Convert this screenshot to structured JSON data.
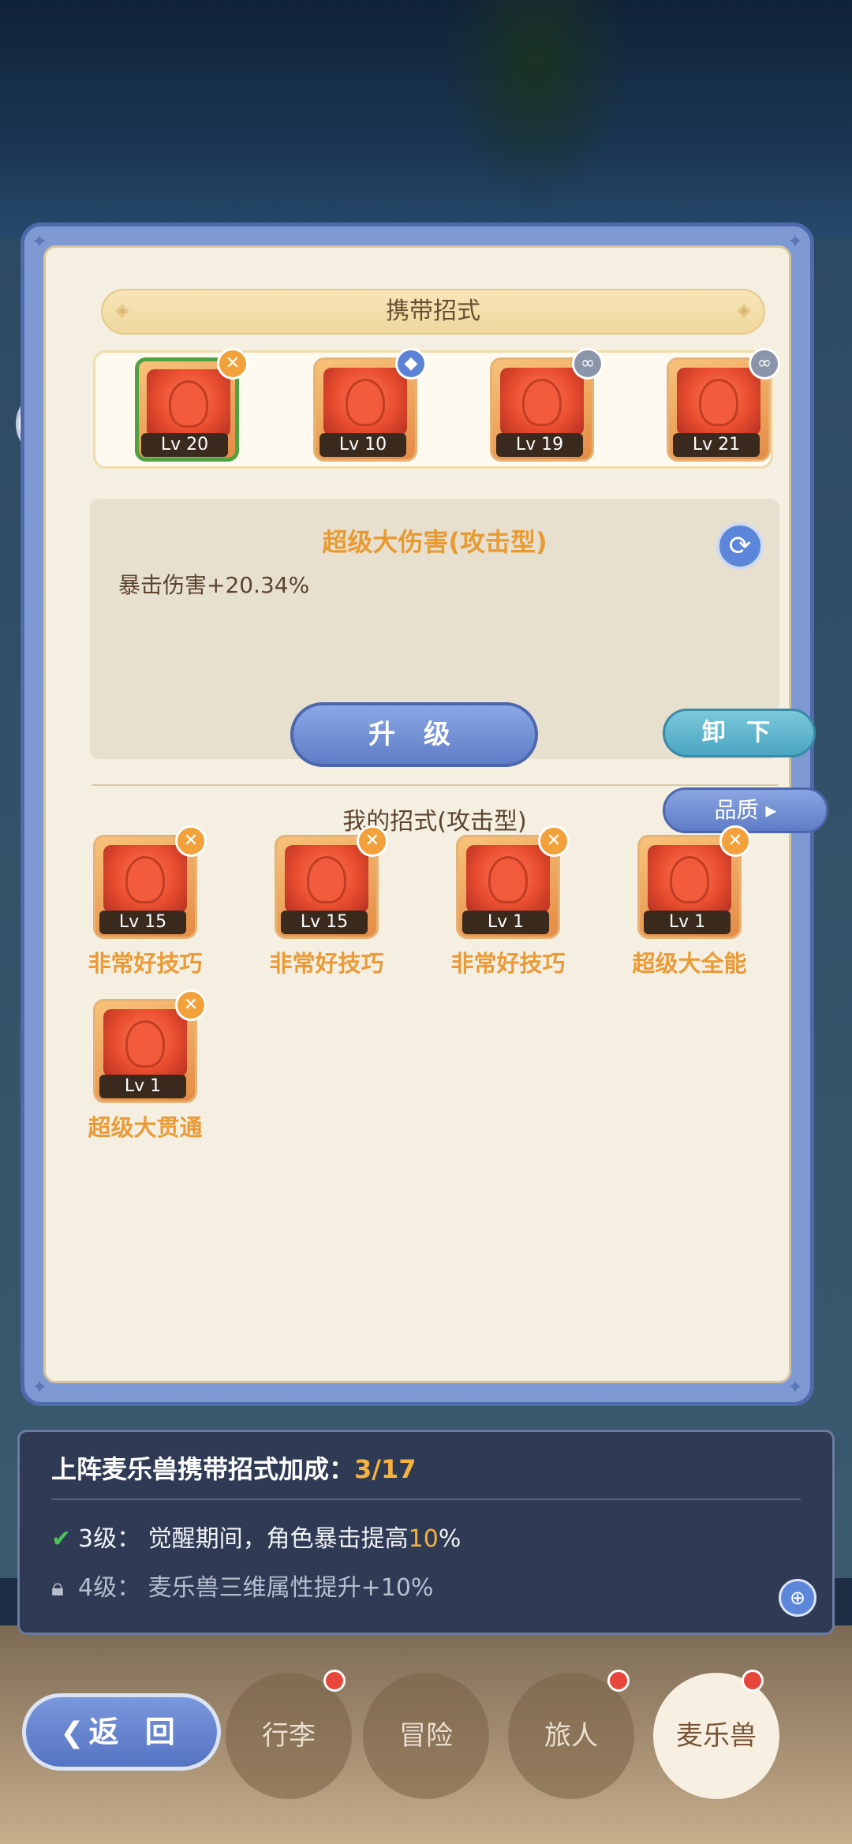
{
  "panel": {
    "title": "携带招式"
  },
  "equipped": [
    {
      "level": "Lv 20",
      "badge_icon": "sword-cross-icon"
    },
    {
      "level": "Lv 10",
      "badge_icon": "shield-icon"
    },
    {
      "level": "Lv 19",
      "badge_icon": "link-icon"
    },
    {
      "level": "Lv 21",
      "badge_icon": "link-icon"
    }
  ],
  "selected_skill": {
    "name": "超级大伤害(攻击型)",
    "effect": "暴击伤害+20.34%"
  },
  "buttons": {
    "upgrade": "升 级",
    "unequip": "卸 下",
    "quality": "品质 ▸",
    "back": "返 回"
  },
  "my_skills": {
    "title": "我的招式(攻击型)",
    "items": [
      {
        "level": "Lv 15",
        "name": "非常好技巧"
      },
      {
        "level": "Lv 15",
        "name": "非常好技巧"
      },
      {
        "level": "Lv 1",
        "name": "非常好技巧"
      },
      {
        "level": "Lv 1",
        "name": "超级大全能"
      },
      {
        "level": "Lv 1",
        "name": "超级大贯通"
      }
    ]
  },
  "bonus": {
    "label": "上阵麦乐兽携带招式加成：",
    "progress": "3/17",
    "line1_prefix": "3级：  觉醒期间，角色暴击提高",
    "line1_value": "10",
    "line1_suffix": "%",
    "line2": "4级：  麦乐兽三维属性提升+10%"
  },
  "nav": {
    "items": [
      "行李",
      "冒险",
      "旅人",
      "麦乐兽"
    ]
  },
  "colors": {
    "accent_orange": "#e89a33",
    "button_blue": "#5f7dc7",
    "button_teal": "#4ba6c1",
    "panel_blue": "#7f99d3"
  }
}
